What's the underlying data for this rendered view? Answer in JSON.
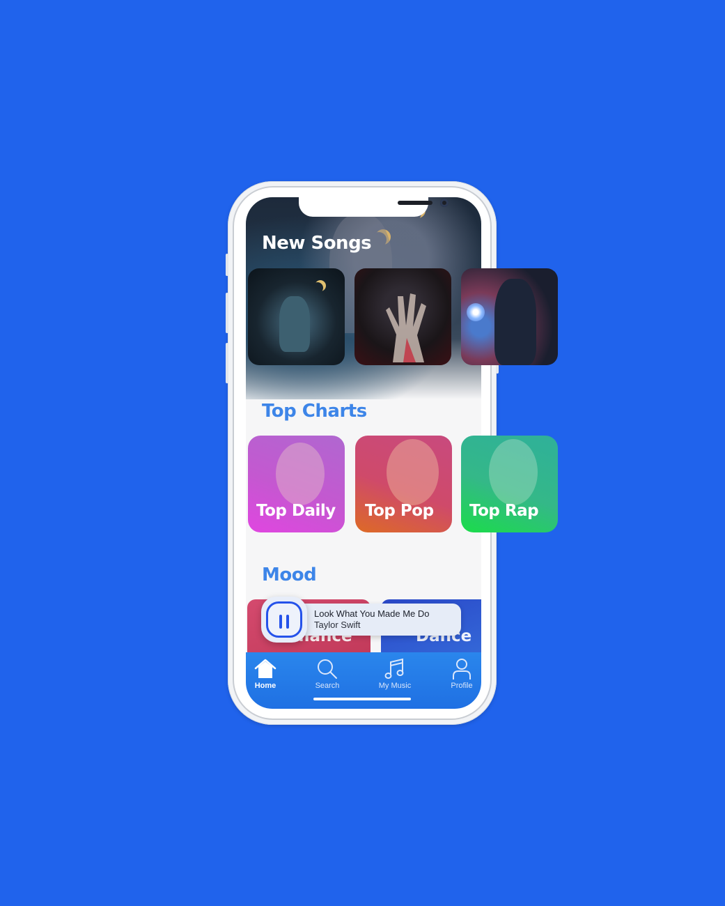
{
  "sections": {
    "new_songs": "New Songs",
    "top_charts": "Top Charts",
    "mood": "Mood"
  },
  "charts": [
    {
      "label": "Top Daily"
    },
    {
      "label": "Top Pop"
    },
    {
      "label": "Top Rap"
    }
  ],
  "moods": [
    {
      "label": "Romance"
    },
    {
      "label": "Dance"
    }
  ],
  "now_playing": {
    "title": "Look What You Made Me Do",
    "artist": "Taylor Swift"
  },
  "tabs": [
    {
      "label": "Home",
      "icon": "home-icon"
    },
    {
      "label": "Search",
      "icon": "search-icon"
    },
    {
      "label": "My Music",
      "icon": "music-note-icon"
    },
    {
      "label": "Profile",
      "icon": "user-icon"
    }
  ],
  "colors": {
    "background": "#2063ec",
    "accent": "#3d85e8",
    "tabbar": "#1f70e3",
    "pause": "#2552ea"
  }
}
